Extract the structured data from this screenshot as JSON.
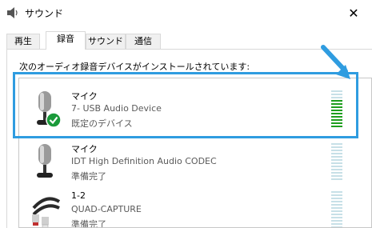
{
  "window": {
    "title": "サウンド",
    "close_glyph": "✕"
  },
  "tabs": [
    {
      "label": "再生"
    },
    {
      "label": "録音"
    },
    {
      "label": "サウンド"
    },
    {
      "label": "通信"
    }
  ],
  "caption": "次のオーディオ録音デバイスがインストールされています:",
  "devices": [
    {
      "name": "マイク",
      "description": "7- USB Audio Device",
      "status": "既定のデバイス",
      "icon": "microphone-icon",
      "default": true,
      "level": 0.72
    },
    {
      "name": "マイク",
      "description": "IDT High Definition Audio CODEC",
      "status": "準備完了",
      "icon": "microphone-icon",
      "default": false,
      "level": 0
    },
    {
      "name": "1-2",
      "description": "QUAD-CAPTURE",
      "status": "準備完了",
      "icon": "rca-cable-icon",
      "default": false,
      "level": 0
    }
  ],
  "colors": {
    "highlight": "#2f9ce0",
    "meter_active": "#1e9e1e",
    "meter_idle": "#c7e0e7",
    "default_check": "#1a9a3a"
  }
}
